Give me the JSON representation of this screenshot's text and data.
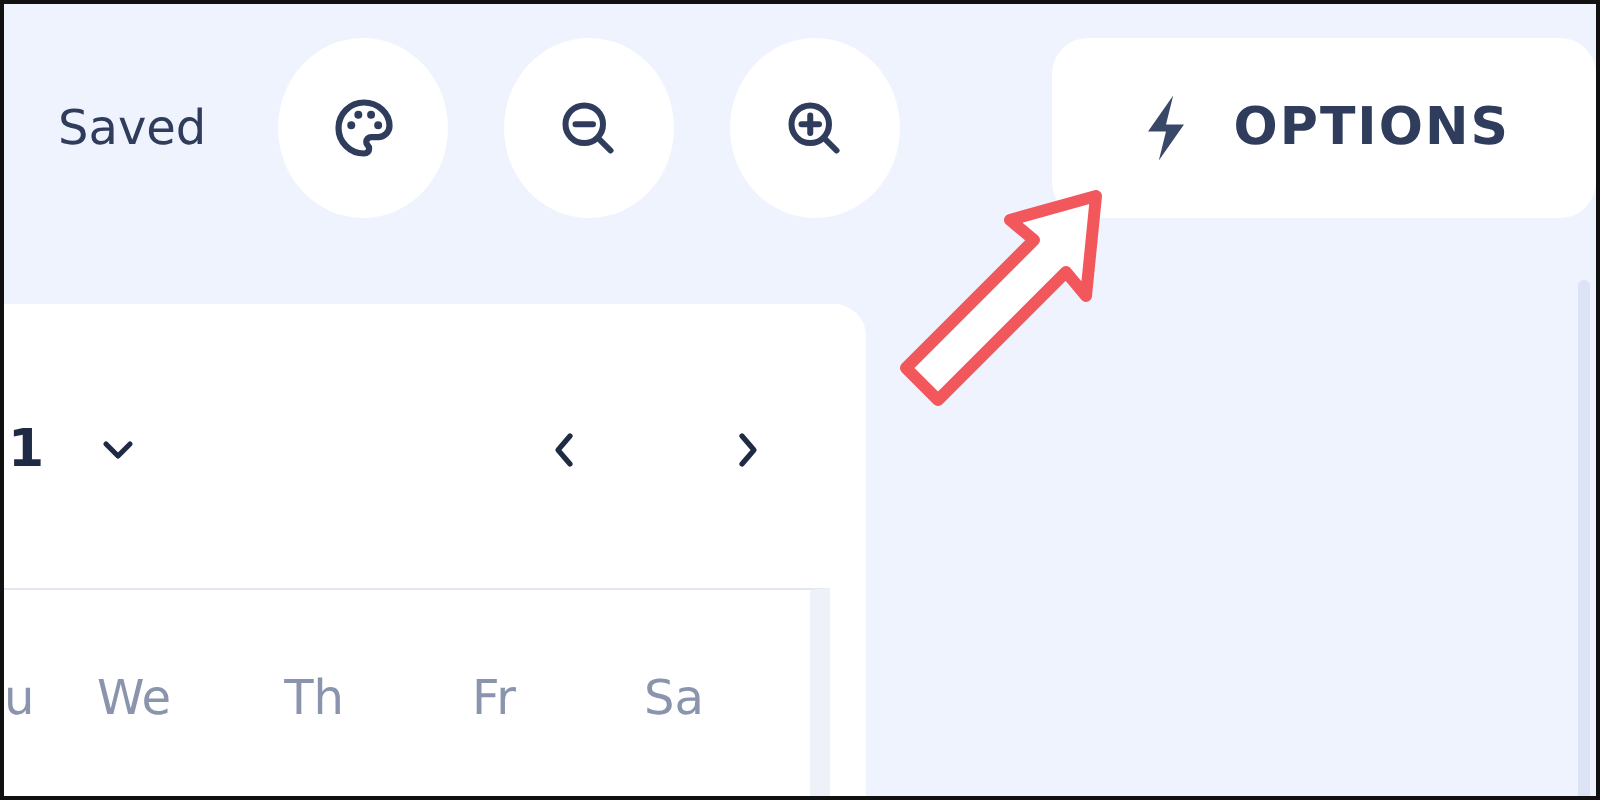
{
  "header": {
    "status": "Saved",
    "tools": [
      {
        "kind": "palette"
      },
      {
        "kind": "zoom-out"
      },
      {
        "kind": "zoom-in"
      }
    ],
    "options_button": {
      "label": "OPTIONS"
    }
  },
  "calendar": {
    "month_label": "1",
    "weekdays": [
      "u",
      "We",
      "Th",
      "Fr",
      "Sa"
    ]
  }
}
